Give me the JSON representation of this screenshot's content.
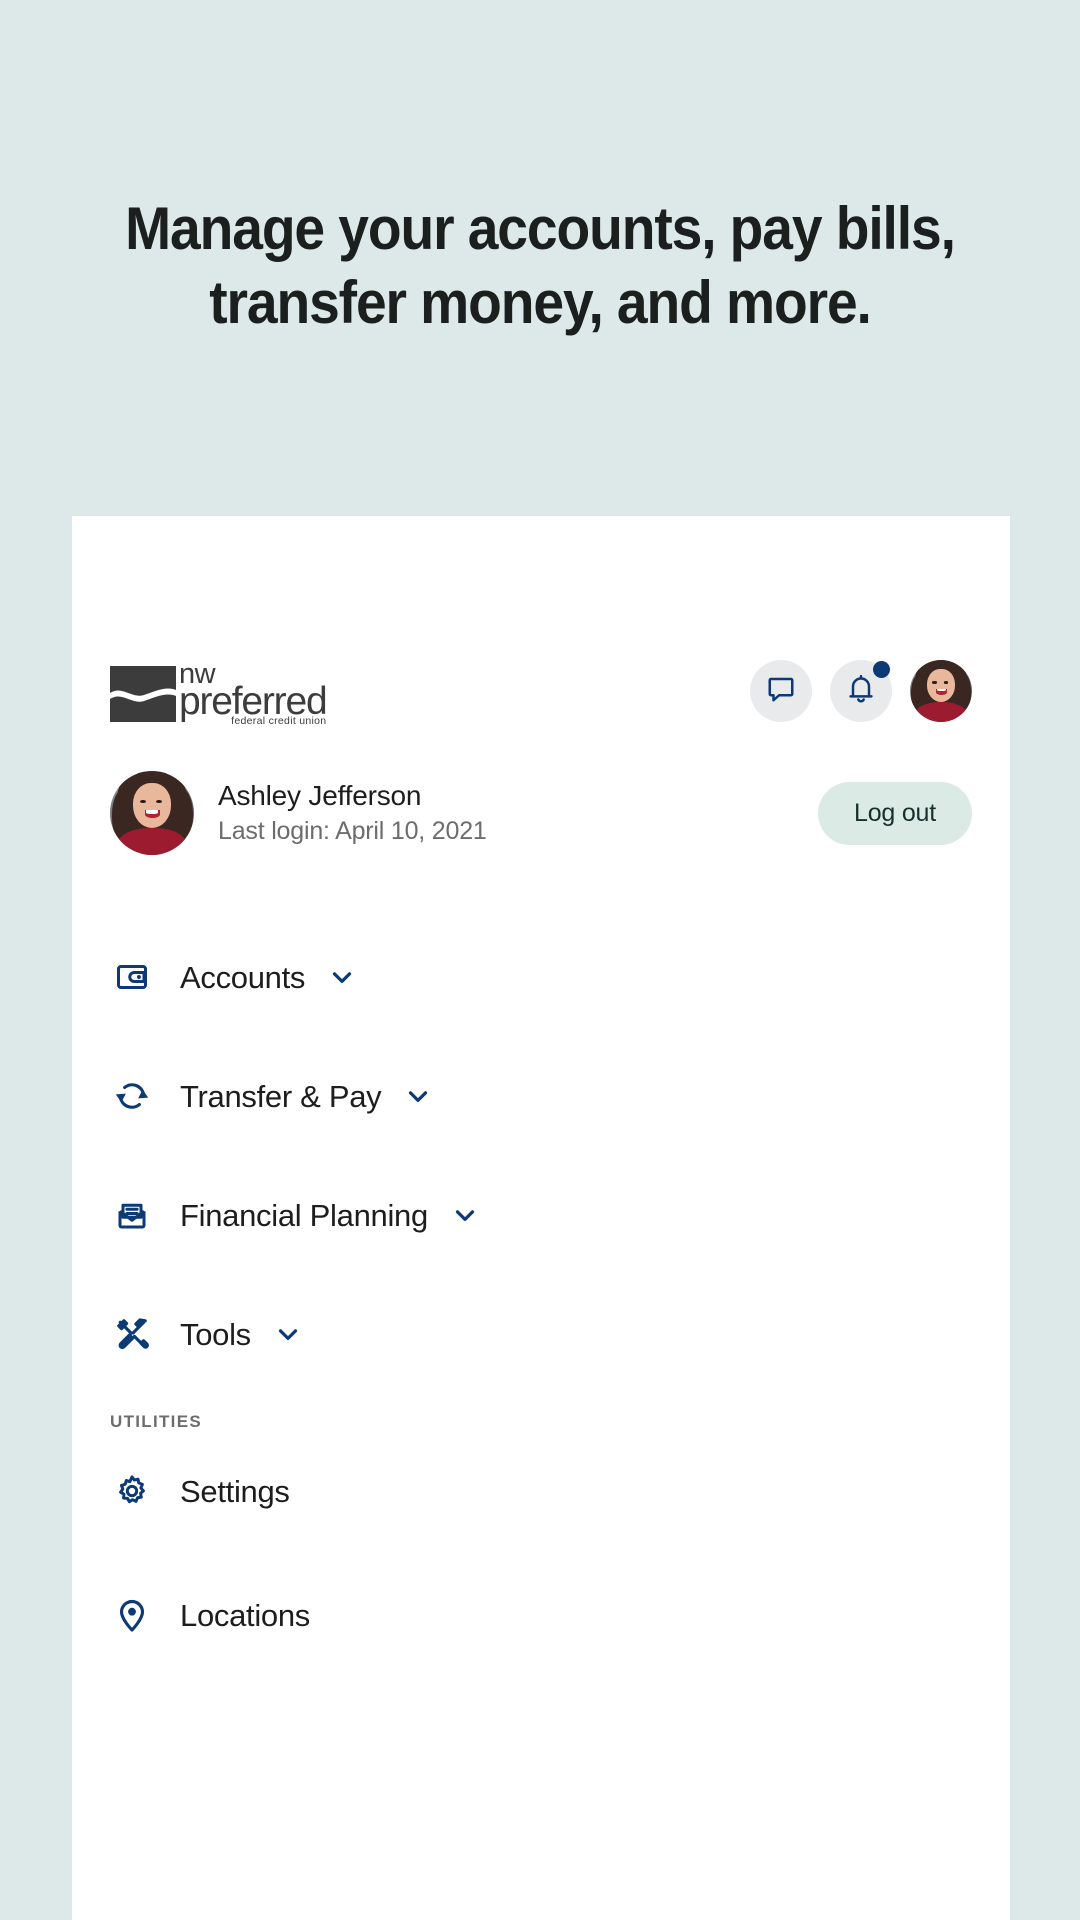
{
  "page": {
    "background_color": "#dde9e8",
    "card_background": "#ffffff",
    "accent_color": "#0d3a74",
    "headline_line1": "Manage your accounts, pay bills,",
    "headline_line2": "transfer money, and more."
  },
  "logo": {
    "name_top": "nw",
    "name_bottom": "preferred",
    "tagline": "federal credit union"
  },
  "topbar": {
    "messages_icon": "chat-bubble-icon",
    "notifications_icon": "bell-icon",
    "has_notification_badge": true,
    "avatar_icon": "user-avatar"
  },
  "profile": {
    "name": "Ashley Jefferson",
    "last_login": "Last login: April 10, 2021",
    "logout_label": "Log out"
  },
  "nav": {
    "primary": [
      {
        "label": "Accounts",
        "icon": "wallet-icon",
        "expandable": true
      },
      {
        "label": "Transfer & Pay",
        "icon": "refresh-arrows-icon",
        "expandable": true
      },
      {
        "label": "Financial Planning",
        "icon": "envelope-document-icon",
        "expandable": true
      },
      {
        "label": "Tools",
        "icon": "hammer-screwdriver-icon",
        "expandable": true
      }
    ],
    "section_label": "UTILITIES",
    "utilities": [
      {
        "label": "Settings",
        "icon": "gear-icon",
        "expandable": false
      },
      {
        "label": "Locations",
        "icon": "map-pin-icon",
        "expandable": false
      }
    ]
  }
}
